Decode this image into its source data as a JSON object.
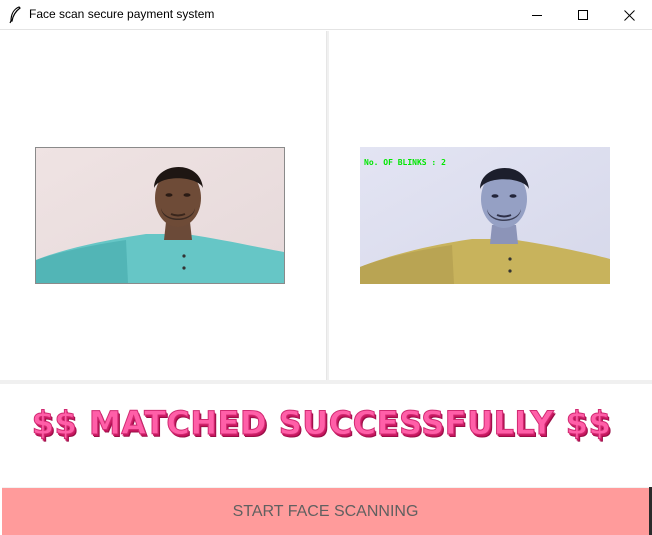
{
  "window": {
    "title": "Face scan secure payment system",
    "icon": "feather-icon",
    "controls": [
      "minimize-icon",
      "maximize-icon",
      "close-icon"
    ]
  },
  "camera_left": {
    "icon": "person-photo",
    "shirt_color": "#5fc4c4",
    "background_color": "#efe2e2"
  },
  "camera_right": {
    "blink_counter": "No. OF BLINKS : 2",
    "counter_color": "#00e600",
    "shirt_color": "#c9b25a",
    "background_color": "#dfe0f0"
  },
  "status": {
    "message": "$$ MATCHED SUCCESSFULLY $$",
    "color": "#ff5fa8"
  },
  "actions": {
    "start_label": "START FACE SCANNING",
    "button_color": "#ff9b9b"
  }
}
